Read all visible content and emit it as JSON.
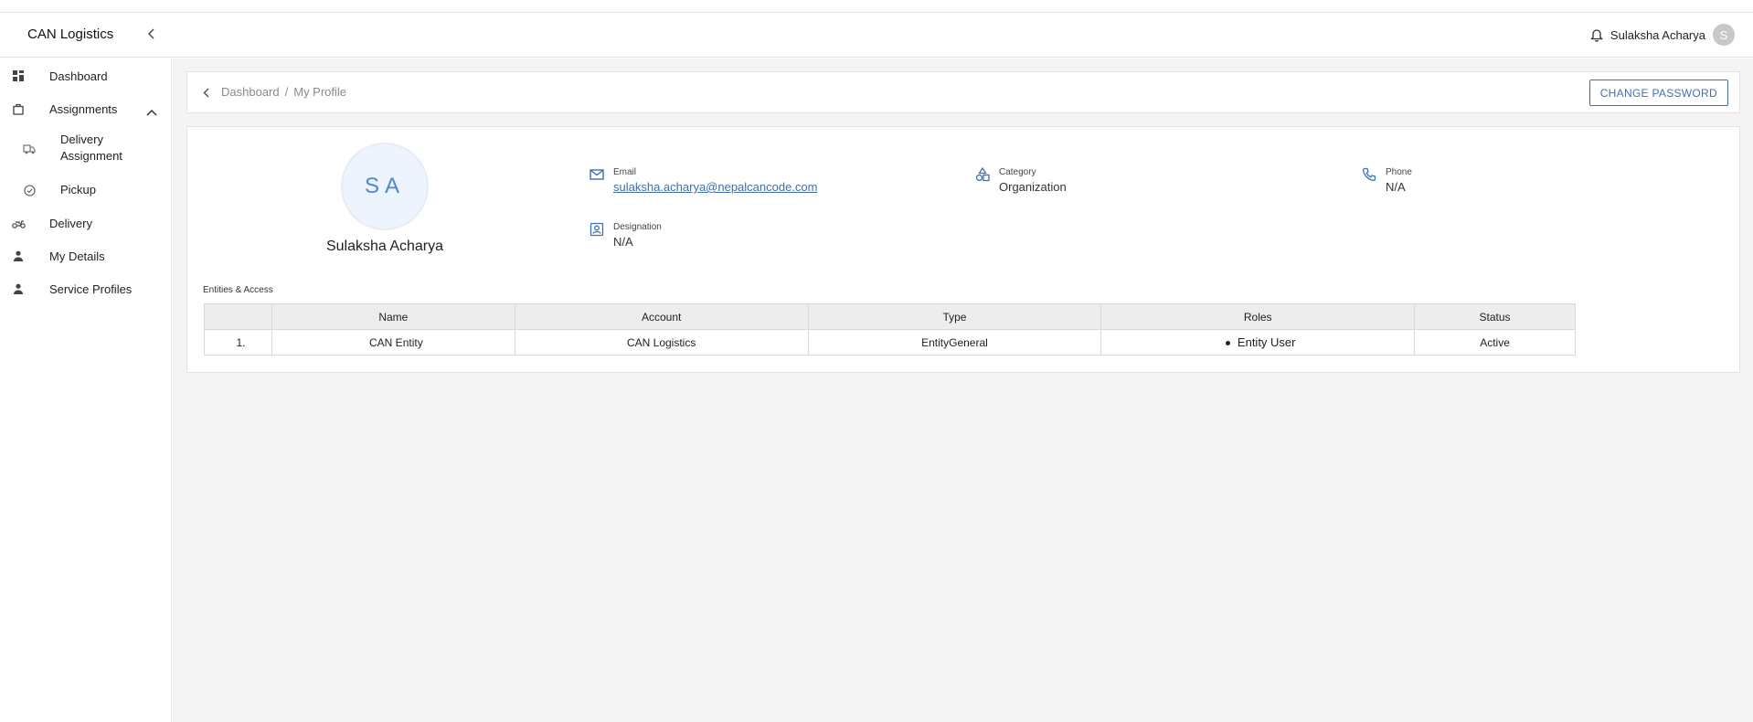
{
  "header": {
    "brand": "CAN Logistics",
    "user_name": "Sulaksha Acharya",
    "user_initial": "S"
  },
  "sidebar": {
    "items": [
      {
        "label": "Dashboard",
        "icon": "dashboard-icon"
      },
      {
        "label": "Assignments",
        "icon": "briefcase-icon",
        "expanded": true
      },
      {
        "label": "Delivery\nAssignment",
        "icon": "truck-icon"
      },
      {
        "label": "Pickup",
        "icon": "check-circle-icon"
      },
      {
        "label": "Delivery",
        "icon": "scooter-icon"
      },
      {
        "label": "My Details",
        "icon": "person-icon"
      },
      {
        "label": "Service Profiles",
        "icon": "person-icon"
      }
    ]
  },
  "breadcrumb": {
    "root": "Dashboard",
    "separator": "/",
    "current": "My Profile"
  },
  "actions": {
    "change_password": "CHANGE PASSWORD"
  },
  "profile": {
    "initials": "SA",
    "name": "Sulaksha Acharya",
    "email_label": "Email",
    "email": "sulaksha.acharya@nepalcancode.com",
    "category_label": "Category",
    "category": "Organization",
    "phone_label": "Phone",
    "phone": "N/A",
    "designation_label": "Designation",
    "designation": "N/A"
  },
  "entities": {
    "title": "Entities & Access",
    "columns": [
      "",
      "Name",
      "Account",
      "Type",
      "Roles",
      "Status"
    ],
    "rows": [
      {
        "index": "1.",
        "name": "CAN Entity",
        "account": "CAN Logistics",
        "type": "EntityGeneral",
        "roles": "Entity User",
        "status": "Active"
      }
    ]
  },
  "colors": {
    "accent": "#3d6fb6",
    "avatar_bg": "#eef4fd",
    "main_bg": "#f4f4f4"
  }
}
